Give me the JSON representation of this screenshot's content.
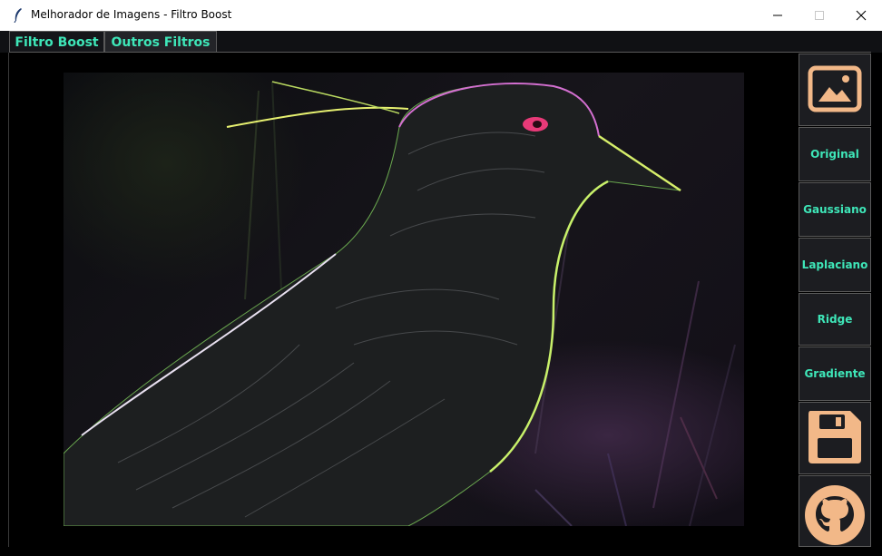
{
  "window": {
    "title": "Melhorador de Imagens - Filtro Boost",
    "controls": {
      "minimize": "—",
      "maximize": "☐",
      "close": "✕"
    }
  },
  "tabs": [
    {
      "label": "Filtro Boost"
    },
    {
      "label": "Outros Filtros"
    }
  ],
  "toolbar": {
    "open_image_icon": "image-icon",
    "buttons": [
      {
        "label": "Original"
      },
      {
        "label": "Gaussiano"
      },
      {
        "label": "Laplaciano"
      },
      {
        "label": "Ridge"
      },
      {
        "label": "Gradiente"
      }
    ],
    "save_icon": "floppy-disk-icon",
    "github_icon": "github-icon"
  },
  "colors": {
    "accent_text": "#3ee6b8",
    "icon_peach": "#f2b888",
    "panel_bg": "#1c1d21",
    "border": "#5a5a5a"
  }
}
